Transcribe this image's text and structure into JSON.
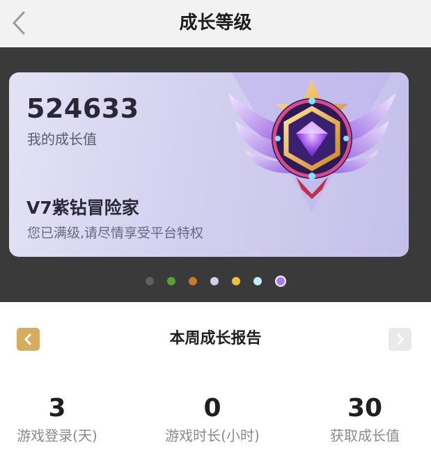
{
  "header": {
    "title": "成长等级"
  },
  "card": {
    "growth_value": "524633",
    "growth_label": "我的成长值",
    "level_name": "V7紫钻冒险家",
    "level_desc": "您已满级,请尽情享受平台特权"
  },
  "carousel": {
    "dot_colors": [
      "#5f5f5f",
      "#5aa033",
      "#c57a2c",
      "#cfcfe8",
      "#efc23c",
      "#bfeef4",
      "#a37cf0"
    ],
    "active_index": 6
  },
  "report": {
    "title": "本周成长报告",
    "stats": [
      {
        "value": "3",
        "label": "游戏登录(天)"
      },
      {
        "value": "0",
        "label": "游戏时长(小时)"
      },
      {
        "value": "30",
        "label": "获取成长值"
      }
    ]
  },
  "colors": {
    "prev_button": "#d6ac5e",
    "next_button": "#e9e9e9",
    "band": "#3a3a3a"
  }
}
